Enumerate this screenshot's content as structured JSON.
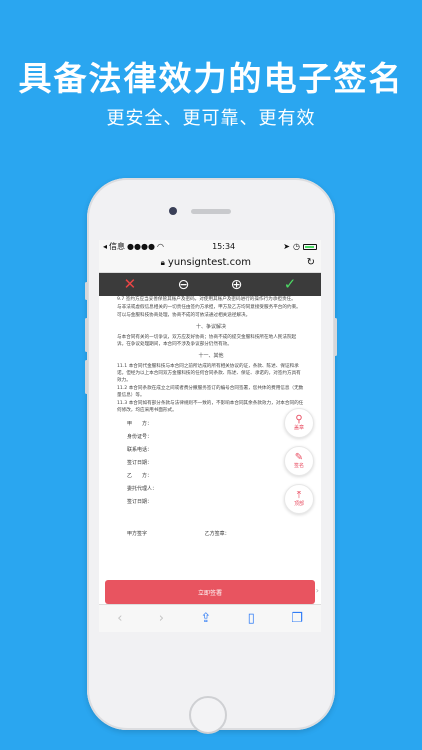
{
  "promo": {
    "headline": "具备法律效力的电子签名",
    "subline": "更安全、更可靠、更有效"
  },
  "status_bar": {
    "back_app": "信息",
    "time": "15:34"
  },
  "browser": {
    "url": "yunsigntest.com"
  },
  "doc_toolbar": {
    "cancel_icon": "close-icon",
    "zoom_out_icon": "zoom-out-icon",
    "zoom_in_icon": "zoom-in-icon",
    "confirm_icon": "check-icon"
  },
  "document": {
    "para_9": "9.7 签约方应当妥善保管其账户及密码，对使用其账户及密码进行的操作行为承担责任。",
    "para_9b": "与非法或虚假信息相关的一切责任由签约方承担，甲方及乙方均同意接受服务平台的约束。",
    "para_9c": "可以与金服科技协商处理，协商不成的可依法通过相关途径解决。",
    "section_10": "十、争议解决",
    "para_10": "与本合同有关的一切争议，双方应友好协商；协商不成的提交金服科技所在地人民法院起诉。在争议处理期间，本合同不涉及争议部分仍然有效。",
    "section_11": "十一、其他",
    "para_11_1": "11.1 本合同代金服科技与本合同之前所达成的所有相关协议的证，条款、陈述、保证和承诺。但经为以上本合同双方金服科技的任何合同条款、陈述、保证、承诺的，对签约方具有效力。",
    "para_11_2": "11.2 本合同条款在成立之间或者费分撒服务签订的编号合同签署，您共体的费用信息（无数量信息）等。",
    "para_11_3": "11.3 本合同如有部分条款与法律规则不一致的，不影响本合同其余条款效力，对本合同的任何修改，均应采用书面形式。",
    "sign_fields": [
      "甲　　方：",
      "身份证号：",
      "联系电话：",
      "签订日期：",
      "乙　　方：",
      "委托代理人：",
      "签订日期："
    ],
    "sign_party_a": "甲方签字",
    "sign_party_b": "乙方签章："
  },
  "fabs": {
    "seal_label": "盖章",
    "sign_label": "签名",
    "top_label": "顶部"
  },
  "actions": {
    "sign_now": "立即签署"
  },
  "colors": {
    "background": "#2aa6f0",
    "accent_red": "#e85460",
    "ios_blue": "#2f7cf6"
  }
}
